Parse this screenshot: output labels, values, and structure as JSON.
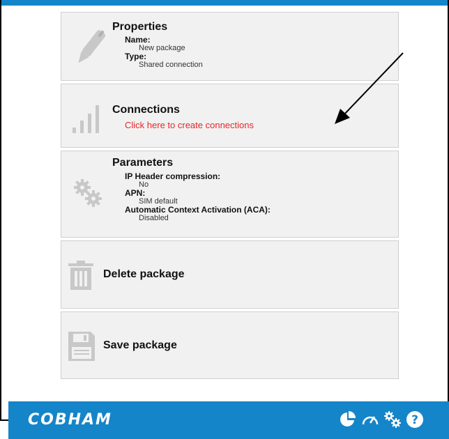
{
  "colors": {
    "accent": "#1585c9",
    "link_red": "#e6262a",
    "panel_bg": "#f1f1f1",
    "icon_gray": "#c8c8c8"
  },
  "properties": {
    "title": "Properties",
    "name_label": "Name:",
    "name_value": "New package",
    "type_label": "Type:",
    "type_value": "Shared connection",
    "icon": "pen-icon"
  },
  "connections": {
    "title": "Connections",
    "link": "Click here to create connections",
    "icon": "signal-bars-icon"
  },
  "parameters": {
    "title": "Parameters",
    "items": [
      {
        "label": "IP Header compression:",
        "value": "No"
      },
      {
        "label": "APN:",
        "value": "SIM default"
      },
      {
        "label": "Automatic Context Activation (ACA):",
        "value": "Disabled"
      }
    ],
    "icon": "gears-icon"
  },
  "delete": {
    "label": "Delete package",
    "icon": "trash-icon"
  },
  "save": {
    "label": "Save package",
    "icon": "floppy-disk-icon"
  },
  "footer": {
    "brand": "COBHAM",
    "icons": [
      "pie-chart-icon",
      "speedometer-icon",
      "gears-icon",
      "help-icon"
    ]
  }
}
